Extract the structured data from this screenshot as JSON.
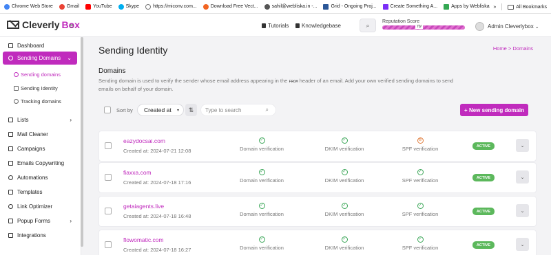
{
  "bookmarks": {
    "items": [
      {
        "label": "Chrome Web Store",
        "icon": "chrome-store-icon",
        "color": "#4285f4"
      },
      {
        "label": "Gmail",
        "icon": "gmail-icon",
        "color": "#ea4335"
      },
      {
        "label": "YouTube",
        "icon": "youtube-icon",
        "color": "#ff0000"
      },
      {
        "label": "Skype",
        "icon": "skype-icon",
        "color": "#00aff0"
      },
      {
        "label": "https://miconv.com...",
        "icon": "globe-icon",
        "color": "#777777"
      },
      {
        "label": "Download Free Vect...",
        "icon": "freepik-icon",
        "color": "#f26522"
      },
      {
        "label": "sahil@webliska.in -...",
        "icon": "mail-icon",
        "color": "#555555"
      },
      {
        "label": "Grid - Ongoing Proj...",
        "icon": "grid-icon",
        "color": "#2b5797"
      },
      {
        "label": "Create Something A...",
        "icon": "app-icon",
        "color": "#7b2ff7"
      },
      {
        "label": "Apps by Webliska",
        "icon": "apps-icon",
        "color": "#34a853"
      }
    ],
    "more": "»",
    "all_bookmarks": "All Bookmarks"
  },
  "header": {
    "logo_text": "Cleverly",
    "logo_accent": "Box",
    "menu_toggle": "≡",
    "tutorials": "Tutorials",
    "knowledgebase": "Knowledgebase",
    "search_icon": "⌕",
    "reputation_label": "Reputation Score",
    "reputation_value": "70/",
    "user_name": "Admin Cleverlybox",
    "user_caret": "⌄"
  },
  "sidebar": {
    "items": [
      {
        "label": "Dashboard",
        "icon": "home-icon"
      },
      {
        "label": "Sending Domains",
        "icon": "globe-icon",
        "chevron": "⌄"
      },
      {
        "label": "Lists",
        "icon": "list-icon",
        "chevron": "›"
      },
      {
        "label": "Mail Cleaner",
        "icon": "mail-icon"
      },
      {
        "label": "Campaigns",
        "icon": "send-icon"
      },
      {
        "label": "Emails Copywriting",
        "icon": "pen-icon"
      },
      {
        "label": "Automations",
        "icon": "gear-icon"
      },
      {
        "label": "Templates",
        "icon": "template-icon"
      },
      {
        "label": "Link Optimizer",
        "icon": "link-icon"
      },
      {
        "label": "Popup Forms",
        "icon": "form-icon",
        "chevron": "›"
      },
      {
        "label": "Integrations",
        "icon": "plug-icon"
      }
    ],
    "sub_items": [
      {
        "label": "Sending domains"
      },
      {
        "label": "Sending Identity"
      },
      {
        "label": "Tracking domains"
      }
    ]
  },
  "page": {
    "title": "Sending Identity",
    "breadcrumb": "Home > Domains",
    "section_title": "Domains",
    "desc_1": "Sending domain is used to verify the sender whose email address appearing in the",
    "desc_code": "FROM",
    "desc_2": "header of an email. Add your own verified sending domains to send emails on behalf of your domain."
  },
  "toolbar": {
    "sort_label": "Sort by",
    "sort_value": "Created at",
    "sort_caret": "▾",
    "sort_dir_icon": "⇅",
    "search_placeholder": "Type to search",
    "search_icon": "⌕",
    "new_button": "+ New sending domain"
  },
  "domains": [
    {
      "name": "eazydocsai.com",
      "created": "Created at: 2024-07-21 12:08",
      "dv": "Domain verification",
      "dkim": "DKIM verification",
      "spf": "SPF verification",
      "spf_status": "warn",
      "status": "ACTIVE"
    },
    {
      "name": "fiaxxa.com",
      "created": "Created at: 2024-07-18 17:16",
      "dv": "Domain verification",
      "dkim": "DKIM verification",
      "spf": "SPF verification",
      "spf_status": "ok",
      "status": "ACTIVE"
    },
    {
      "name": "getaiagents.live",
      "created": "Created at: 2024-07-18 16:48",
      "dv": "Domain verification",
      "dkim": "DKIM verification",
      "spf": "SPF verification",
      "spf_status": "ok",
      "status": "ACTIVE"
    },
    {
      "name": "flowomatic.com",
      "created": "Created at: 2024-07-18 16:27",
      "dv": "Domain verification",
      "dkim": "DKIM verification",
      "spf": "SPF verification",
      "spf_status": "ok",
      "status": "ACTIVE"
    }
  ],
  "colors": {
    "accent": "#c02bbd",
    "active_badge": "#5cb85c",
    "verified": "#3aa657",
    "warning": "#e07b39"
  }
}
